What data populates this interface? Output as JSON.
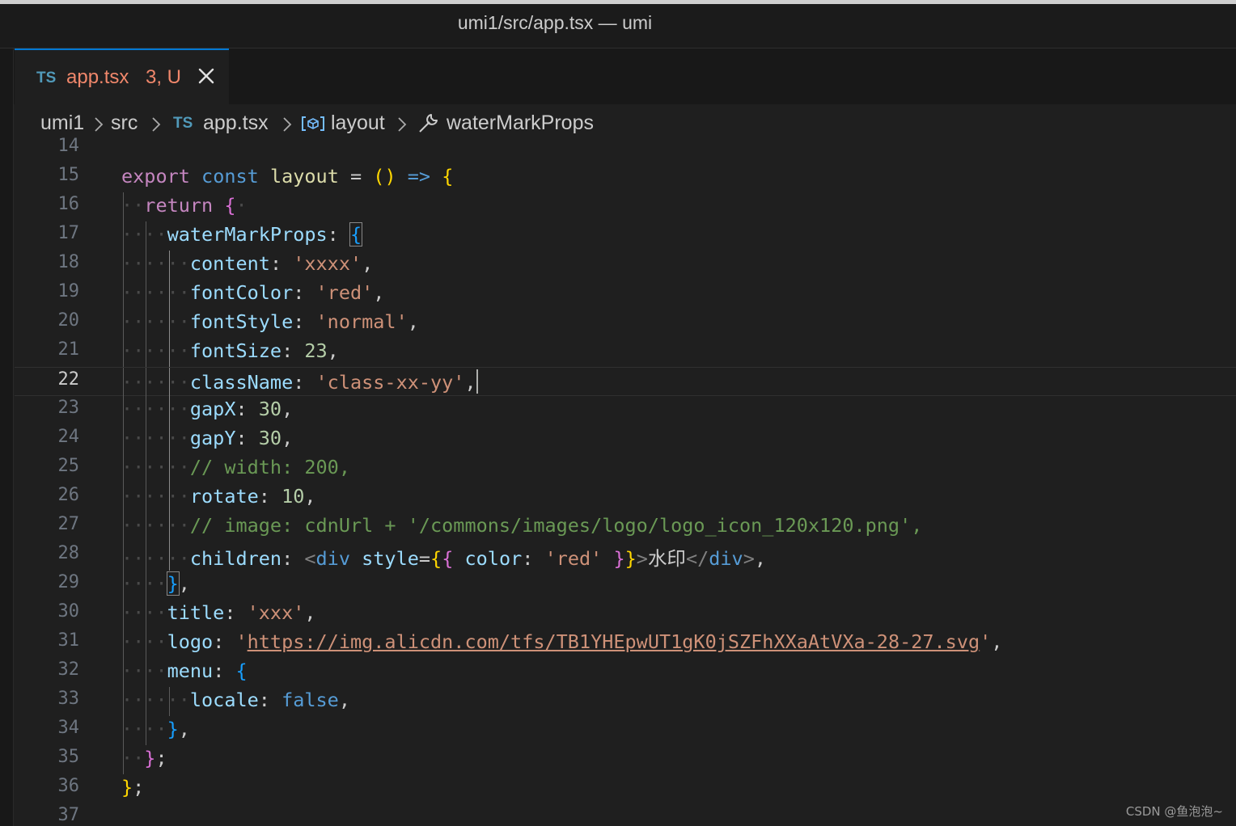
{
  "window": {
    "title": "umi1/src/app.tsx — umi"
  },
  "tab": {
    "lang_badge": "TS",
    "filename": "app.tsx",
    "status": "3, U"
  },
  "breadcrumb": {
    "items": [
      {
        "label": "umi1"
      },
      {
        "label": "src"
      },
      {
        "label": "app.tsx",
        "badge": "TS"
      },
      {
        "label": "layout",
        "icon": "variable-icon"
      },
      {
        "label": "waterMarkProps",
        "icon": "wrench-icon"
      }
    ]
  },
  "editor": {
    "active_line": 22,
    "line_numbers": [
      "14",
      "15",
      "16",
      "17",
      "18",
      "19",
      "20",
      "21",
      "22",
      "23",
      "24",
      "25",
      "26",
      "27",
      "28",
      "29",
      "30",
      "31",
      "32",
      "33",
      "34",
      "35",
      "36",
      "37"
    ],
    "lines": [
      "",
      "export const layout = () => {",
      "  return {",
      "    waterMarkProps: {",
      "      content: 'xxxx',",
      "      fontColor: 'red',",
      "      fontStyle: 'normal',",
      "      fontSize: 23,",
      "      className: 'class-xx-yy',",
      "      gapX: 30,",
      "      gapY: 30,",
      "      // width: 200,",
      "      rotate: 10,",
      "      // image: cdnUrl + '/commons/images/logo/logo_icon_120x120.png',",
      "      children: <div style={{ color: 'red' }}>水印</div>,",
      "    },",
      "    title: 'xxx',",
      "    logo: 'https://img.alicdn.com/tfs/TB1YHEpwUT1gK0jSZFhXXaAtVXa-28-27.svg',",
      "    menu: {",
      "      locale: false,",
      "    },",
      "  };",
      "};",
      ""
    ]
  },
  "watermark": "CSDN @鱼泡泡~"
}
